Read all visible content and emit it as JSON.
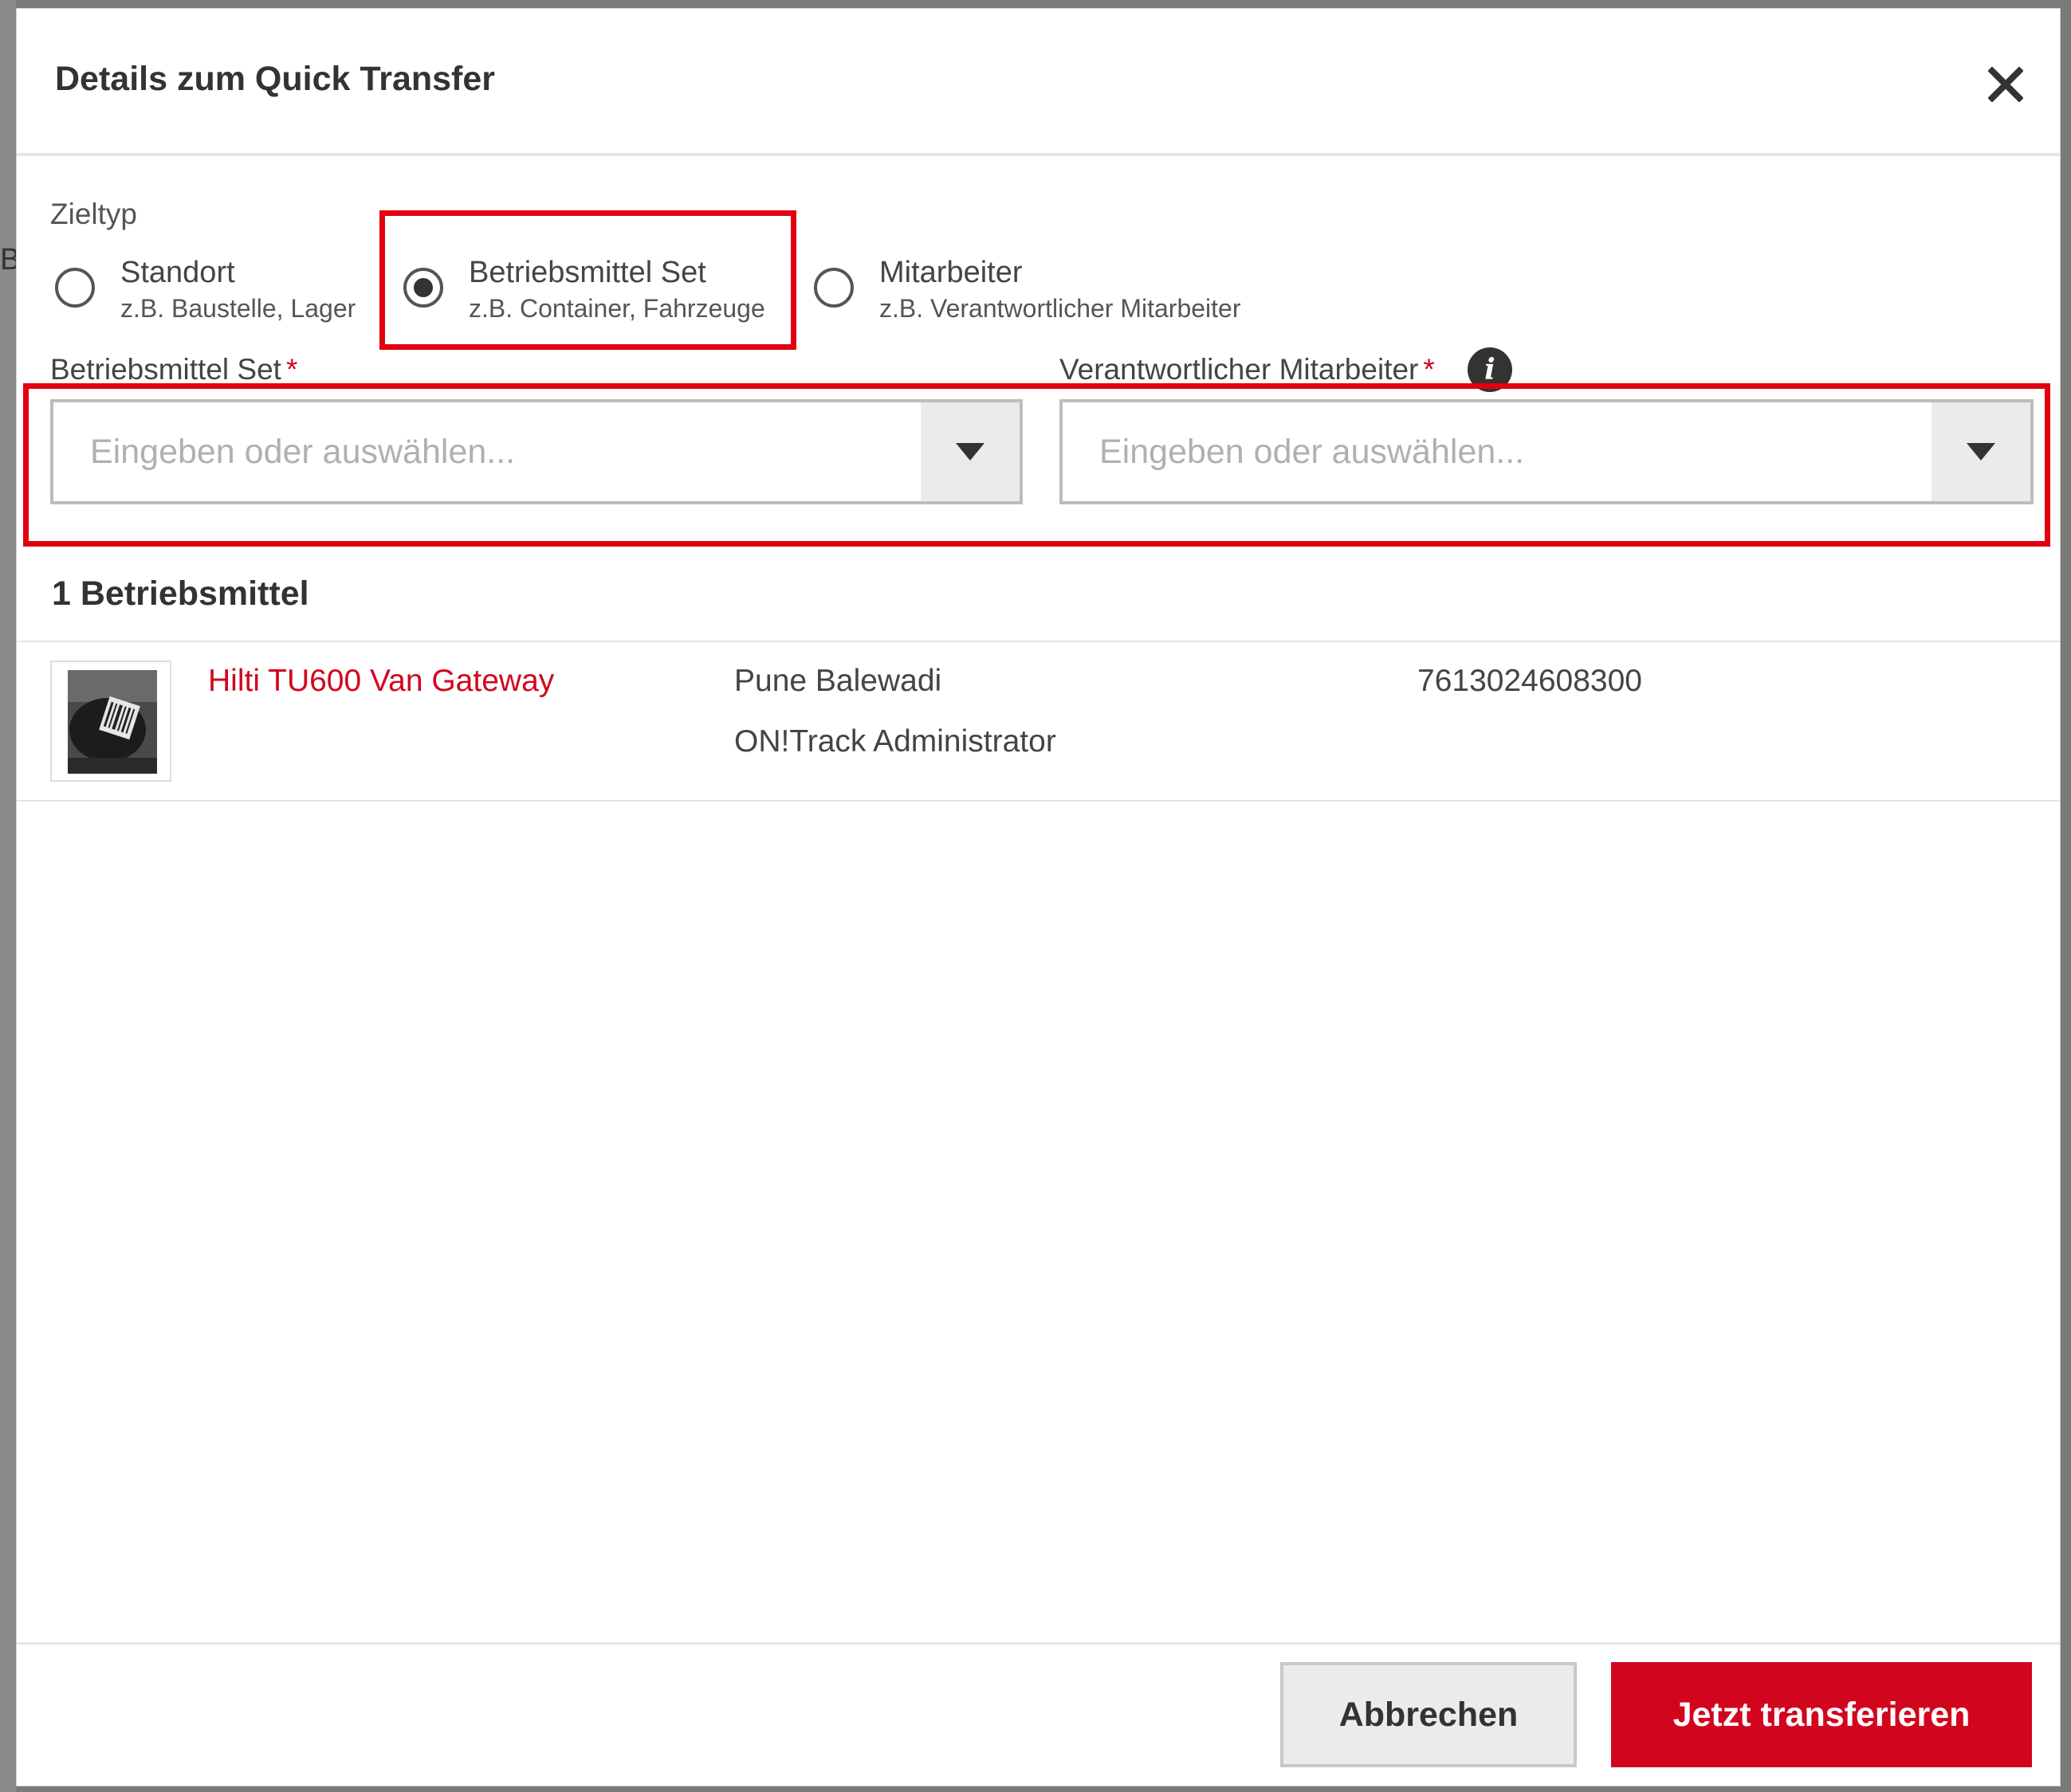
{
  "background": {
    "edge_letter": "B"
  },
  "modal": {
    "title": "Details zum Quick Transfer",
    "close_icon": "close-icon"
  },
  "target_type": {
    "label": "Zieltyp",
    "options": [
      {
        "title": "Standort",
        "subtitle": "z.B. Baustelle, Lager",
        "checked": false
      },
      {
        "title": "Betriebsmittel Set",
        "subtitle": "z.B. Container, Fahrzeuge",
        "checked": true
      },
      {
        "title": "Mitarbeiter",
        "subtitle": "z.B. Verantwortlicher Mitarbeiter",
        "checked": false
      }
    ]
  },
  "fields": {
    "asset_set": {
      "label": "Betriebsmittel Set",
      "required_mark": "*",
      "placeholder": "Eingeben oder auswählen..."
    },
    "responsible": {
      "label": "Verantwortlicher Mitarbeiter",
      "required_mark": "*",
      "placeholder": "Eingeben oder auswählen...",
      "info_icon": "i"
    }
  },
  "assets": {
    "heading": "1 Betriebsmittel",
    "items": [
      {
        "name": "Hilti TU600 Van Gateway",
        "location": "Pune Balewadi",
        "owner": "ON!Track Administrator",
        "serial": "7613024608300"
      }
    ]
  },
  "footer": {
    "cancel_label": "Abbrechen",
    "submit_label": "Jetzt transferieren"
  },
  "colors": {
    "accent": "#d2051e",
    "highlight": "#e20010"
  }
}
